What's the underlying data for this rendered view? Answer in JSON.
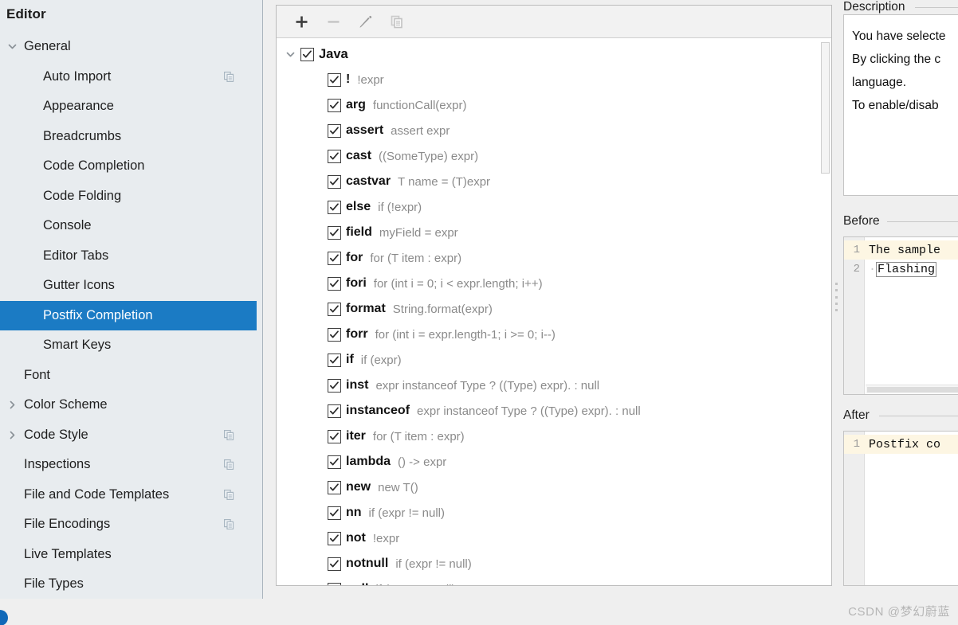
{
  "sidebar": {
    "title": "Editor",
    "items": [
      {
        "label": "General",
        "indent": 0,
        "twisty": "chevron-down-icon",
        "copy": false,
        "selected": false
      },
      {
        "label": "Auto Import",
        "indent": 1,
        "twisty": "none",
        "copy": true,
        "selected": false
      },
      {
        "label": "Appearance",
        "indent": 1,
        "twisty": "none",
        "copy": false,
        "selected": false
      },
      {
        "label": "Breadcrumbs",
        "indent": 1,
        "twisty": "none",
        "copy": false,
        "selected": false
      },
      {
        "label": "Code Completion",
        "indent": 1,
        "twisty": "none",
        "copy": false,
        "selected": false
      },
      {
        "label": "Code Folding",
        "indent": 1,
        "twisty": "none",
        "copy": false,
        "selected": false
      },
      {
        "label": "Console",
        "indent": 1,
        "twisty": "none",
        "copy": false,
        "selected": false
      },
      {
        "label": "Editor Tabs",
        "indent": 1,
        "twisty": "none",
        "copy": false,
        "selected": false
      },
      {
        "label": "Gutter Icons",
        "indent": 1,
        "twisty": "none",
        "copy": false,
        "selected": false
      },
      {
        "label": "Postfix Completion",
        "indent": 1,
        "twisty": "none",
        "copy": false,
        "selected": true
      },
      {
        "label": "Smart Keys",
        "indent": 1,
        "twisty": "none",
        "copy": false,
        "selected": false
      },
      {
        "label": "Font",
        "indent": 0,
        "twisty": "none",
        "copy": false,
        "selected": false
      },
      {
        "label": "Color Scheme",
        "indent": 0,
        "twisty": "chevron-right-icon",
        "copy": false,
        "selected": false
      },
      {
        "label": "Code Style",
        "indent": 0,
        "twisty": "chevron-right-icon",
        "copy": true,
        "selected": false
      },
      {
        "label": "Inspections",
        "indent": 0,
        "twisty": "none",
        "copy": true,
        "selected": false
      },
      {
        "label": "File and Code Templates",
        "indent": 0,
        "twisty": "none",
        "copy": true,
        "selected": false
      },
      {
        "label": "File Encodings",
        "indent": 0,
        "twisty": "none",
        "copy": true,
        "selected": false
      },
      {
        "label": "Live Templates",
        "indent": 0,
        "twisty": "none",
        "copy": false,
        "selected": false
      },
      {
        "label": "File Types",
        "indent": 0,
        "twisty": "none",
        "copy": false,
        "selected": false
      }
    ]
  },
  "toolbar": {
    "buttons": [
      {
        "name": "add-button",
        "icon": "plus-icon",
        "enabled": true
      },
      {
        "name": "remove-button",
        "icon": "minus-icon",
        "enabled": false
      },
      {
        "name": "edit-button",
        "icon": "pencil-icon",
        "enabled": true
      },
      {
        "name": "duplicate-button",
        "icon": "copy-icon",
        "enabled": false
      }
    ]
  },
  "template_list": {
    "root": {
      "key": "Java",
      "desc": "",
      "checked": true,
      "expanded": true
    },
    "items": [
      {
        "key": "!",
        "desc": "!expr"
      },
      {
        "key": "arg",
        "desc": "functionCall(expr)"
      },
      {
        "key": "assert",
        "desc": "assert expr"
      },
      {
        "key": "cast",
        "desc": "((SomeType) expr)"
      },
      {
        "key": "castvar",
        "desc": "T name = (T)expr"
      },
      {
        "key": "else",
        "desc": "if (!expr)"
      },
      {
        "key": "field",
        "desc": "myField = expr"
      },
      {
        "key": "for",
        "desc": "for (T item : expr)"
      },
      {
        "key": "fori",
        "desc": "for (int i = 0; i < expr.length; i++)"
      },
      {
        "key": "format",
        "desc": "String.format(expr)"
      },
      {
        "key": "forr",
        "desc": "for (int i = expr.length-1; i >= 0; i--)"
      },
      {
        "key": "if",
        "desc": "if (expr)"
      },
      {
        "key": "inst",
        "desc": "expr instanceof Type ? ((Type) expr). : null"
      },
      {
        "key": "instanceof",
        "desc": "expr instanceof Type ? ((Type) expr). : null"
      },
      {
        "key": "iter",
        "desc": "for (T item : expr)"
      },
      {
        "key": "lambda",
        "desc": "() -> expr"
      },
      {
        "key": "new",
        "desc": "new T()"
      },
      {
        "key": "nn",
        "desc": "if (expr != null)"
      },
      {
        "key": "not",
        "desc": "!expr"
      },
      {
        "key": "notnull",
        "desc": "if (expr != null)"
      },
      {
        "key": "null",
        "desc": "if (expr == null)"
      }
    ]
  },
  "right_panel": {
    "description": {
      "title": "Description",
      "text": "You have selecte\nBy clicking the c\nlanguage.\nTo enable/disab"
    },
    "before": {
      "title": "Before",
      "lines": [
        {
          "number": "1",
          "text": "The sample",
          "highlight": true,
          "selection": ""
        },
        {
          "number": "2",
          "text": "",
          "highlight": false,
          "selection": "Flashing"
        }
      ]
    },
    "after": {
      "title": "After",
      "lines": [
        {
          "number": "1",
          "text": "Postfix co",
          "highlight": true,
          "selection": ""
        }
      ]
    }
  },
  "watermark": {
    "text": "CSDN @梦幻蔚蓝"
  },
  "colors": {
    "selection_blue": "#1b7bc4",
    "sidebar_bg": "#e8ecef",
    "panel_bg": "#efefef",
    "code_highlight": "#fdf6e3",
    "desc_gray": "#8b8b8b"
  }
}
